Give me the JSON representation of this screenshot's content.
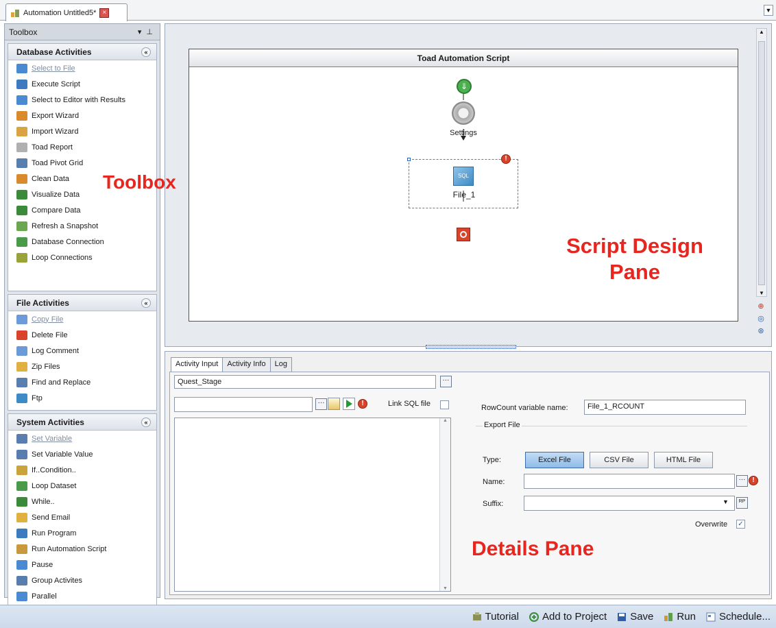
{
  "document_tab": {
    "title": "Automation Untitled5*"
  },
  "toolbox": {
    "title": "Toolbox",
    "sections": [
      {
        "title": "Database Activities",
        "items": [
          {
            "label": "Select to File",
            "icon": "select-to-file-icon",
            "muted": true
          },
          {
            "label": "Execute Script",
            "icon": "execute-script-icon",
            "muted": false
          },
          {
            "label": "Select to Editor with Results",
            "icon": "select-to-editor-icon",
            "muted": false
          },
          {
            "label": "Export Wizard",
            "icon": "export-wizard-icon",
            "muted": false
          },
          {
            "label": "Import Wizard",
            "icon": "import-wizard-icon",
            "muted": false
          },
          {
            "label": "Toad Report",
            "icon": "toad-report-icon",
            "muted": false
          },
          {
            "label": "Toad Pivot Grid",
            "icon": "pivot-grid-icon",
            "muted": false
          },
          {
            "label": "Clean Data",
            "icon": "clean-data-icon",
            "muted": false
          },
          {
            "label": "Visualize Data",
            "icon": "visualize-data-icon",
            "muted": false
          },
          {
            "label": "Compare Data",
            "icon": "compare-data-icon",
            "muted": false
          },
          {
            "label": "Refresh a Snapshot",
            "icon": "refresh-snapshot-icon",
            "muted": false
          },
          {
            "label": "Database Connection",
            "icon": "database-connection-icon",
            "muted": false
          },
          {
            "label": "Loop Connections",
            "icon": "loop-connections-icon",
            "muted": false
          }
        ]
      },
      {
        "title": "File Activities",
        "items": [
          {
            "label": "Copy File",
            "icon": "copy-file-icon",
            "muted": true
          },
          {
            "label": "Delete File",
            "icon": "delete-file-icon",
            "muted": false
          },
          {
            "label": "Log Comment",
            "icon": "log-comment-icon",
            "muted": false
          },
          {
            "label": "Zip Files",
            "icon": "zip-files-icon",
            "muted": false
          },
          {
            "label": "Find and Replace",
            "icon": "find-replace-icon",
            "muted": false
          },
          {
            "label": "Ftp",
            "icon": "ftp-icon",
            "muted": false
          }
        ]
      },
      {
        "title": "System Activities",
        "items": [
          {
            "label": "Set Variable",
            "icon": "set-variable-icon",
            "muted": true
          },
          {
            "label": "Set Variable Value",
            "icon": "set-variable-value-icon",
            "muted": false
          },
          {
            "label": "If..Condition..",
            "icon": "if-condition-icon",
            "muted": false
          },
          {
            "label": "Loop Dataset",
            "icon": "loop-dataset-icon",
            "muted": false
          },
          {
            "label": "While..",
            "icon": "while-icon",
            "muted": false
          },
          {
            "label": "Send Email",
            "icon": "send-email-icon",
            "muted": false
          },
          {
            "label": "Run Program",
            "icon": "run-program-icon",
            "muted": false
          },
          {
            "label": "Run Automation Script",
            "icon": "run-automation-script-icon",
            "muted": false
          },
          {
            "label": "Pause",
            "icon": "pause-icon",
            "muted": false
          },
          {
            "label": "Group Activites",
            "icon": "group-activities-icon",
            "muted": false
          },
          {
            "label": "Parallel",
            "icon": "parallel-icon",
            "muted": false
          }
        ]
      }
    ]
  },
  "design": {
    "canvas_title": "Toad Automation Script",
    "settings_label": "Settings",
    "activity_label": "File_1"
  },
  "details": {
    "tabs": [
      "Activity Input",
      "Activity Info",
      "Log"
    ],
    "connection_value": "Quest_Stage",
    "sql_file_value": "",
    "link_sql_label": "Link SQL file",
    "rowcount_label": "RowCount variable name:",
    "rowcount_value": "File_1_RCOUNT",
    "export_group_label": "Export File",
    "type_label": "Type:",
    "type_buttons": [
      "Excel File",
      "CSV File",
      "HTML File"
    ],
    "selected_type": "Excel File",
    "name_label": "Name:",
    "name_value": "",
    "suffix_label": "Suffix:",
    "suffix_value": "",
    "overwrite_label": "Overwrite",
    "overwrite_checked": true
  },
  "statusbar": {
    "tutorial": "Tutorial",
    "add_to_project": "Add to Project",
    "save": "Save",
    "run": "Run",
    "schedule": "Schedule..."
  },
  "annotations": {
    "toolbox": "Toolbox",
    "design_pane_line1": "Script Design",
    "design_pane_line2": "Pane",
    "details_pane": "Details Pane"
  },
  "colors": {
    "callout": "#e6261f",
    "selected_button": "#90bce8",
    "error": "#d9432b"
  }
}
